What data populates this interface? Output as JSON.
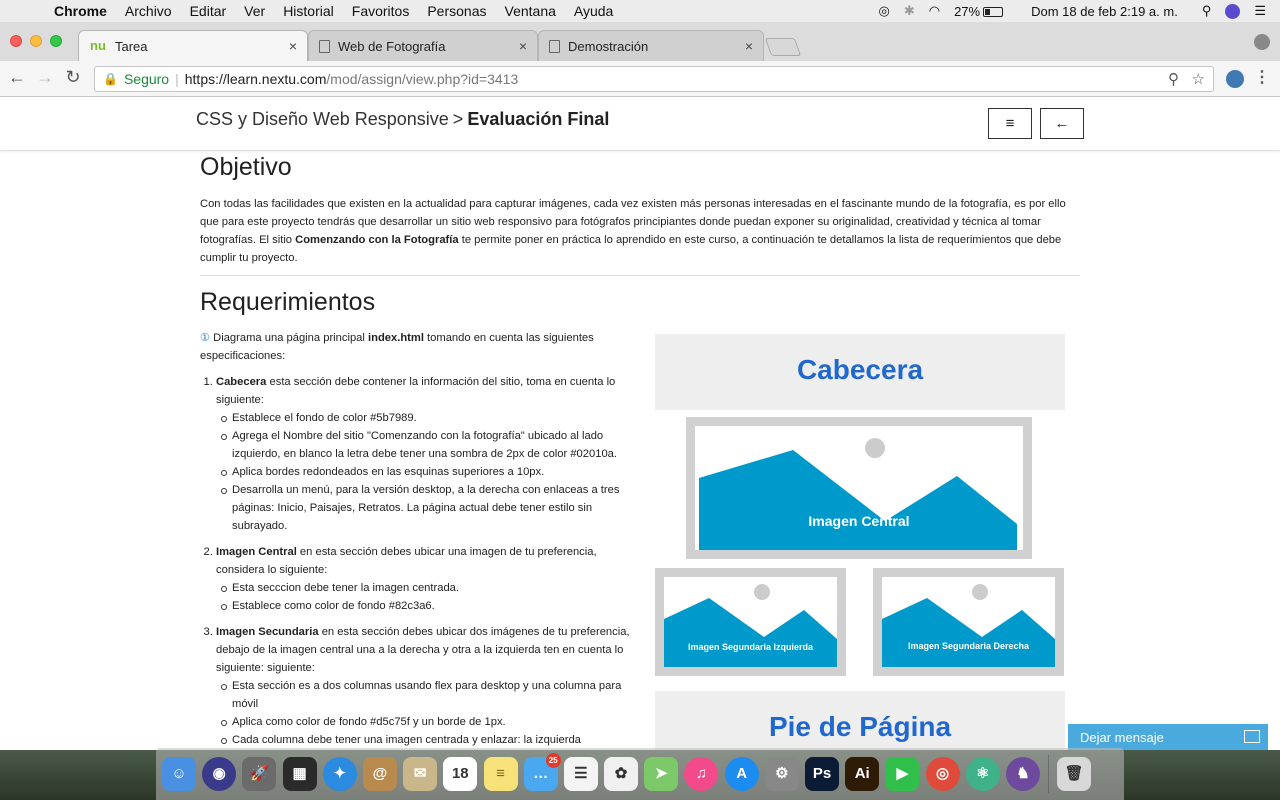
{
  "menubar": {
    "apple": "",
    "app_name": "Chrome",
    "items": [
      "Archivo",
      "Editar",
      "Ver",
      "Historial",
      "Favoritos",
      "Personas",
      "Ventana",
      "Ayuda"
    ],
    "battery": "27%",
    "datetime": "Dom 18 de feb  2:19 a. m."
  },
  "browser": {
    "tabs": [
      {
        "label": "Tarea",
        "favicon": "nextu-logo",
        "favicon_text": "nu",
        "close": "×"
      },
      {
        "label": "Web de Fotografía",
        "favicon": "document-icon",
        "close": "×"
      },
      {
        "label": "Demostración",
        "favicon": "document-icon",
        "close": "×"
      }
    ],
    "secure_label": "Seguro",
    "url_host": "https://learn.nextu.com",
    "url_path": "/mod/assign/view.php?id=3413",
    "back": "←",
    "forward": "→",
    "reload": "↻",
    "zoom": "⚲",
    "star": "☆",
    "menu": "⋮"
  },
  "page": {
    "breadcrumb_course": "CSS y Diseño Web Responsive",
    "breadcrumb_sep": ">",
    "breadcrumb_current": "Evaluación Final",
    "menu_button": "≡",
    "back_button": "←",
    "objective_title": "Objetivo",
    "intro_1": "Con todas las facilidades que existen en la actualidad para capturar imágenes, cada vez existen más personas interesadas en el fascinante mundo de la fotografía, es por ello que para este proyecto tendrás que desarrollar un sitio web responsivo para fotógrafos principiantes donde puedan exponer su originalidad, creatividad y técnica al tomar fotografías. El sitio ",
    "intro_bold": "Comenzando con la Fotografía",
    "intro_2": " te permite poner en práctica lo aprendido en este curso, a continuación te detallamos la lista de requerimientos que debe cumplir tu proyecto.",
    "requirements_title": "Requerimientos",
    "req_number": "①",
    "req_intro_1": " Diagrama una página principal ",
    "req_intro_bold": "index.html",
    "req_intro_2": " tomando en cuenta las siguientes especificaciones:",
    "sections": [
      {
        "name": "Cabecera",
        "text": " esta sección debe contener la información del sitio, toma en cuenta lo siguiente:",
        "bullets": [
          "Establece el fondo de color #5b7989.",
          "Agrega el Nombre del sitio \"Comenzando con la fotografía\" ubicado al lado izquierdo, en blanco la letra debe tener una sombra de 2px de color #02010a.",
          "Aplica bordes redondeados en las esquinas superiores a 10px.",
          "Desarrolla un menú, para la versión desktop, a la derecha con enlaceas a tres páginas: Inicio, Paisajes, Retratos. La página actual debe tener estilo sin subrayado."
        ]
      },
      {
        "name": "Imagen Central",
        "text": " en esta sección debes ubicar una imagen de tu preferencia, considera lo siguiente:",
        "bullets": [
          "Esta secccion debe tener la imagen centrada.",
          "Establece como color de fondo #82c3a6."
        ]
      },
      {
        "name": "Imagen Secundaria",
        "text": " en esta sección debes ubicar dos imágenes de tu preferencia, debajo de la imagen central una a la derecha y otra a la izquierda ten en cuenta lo siguiente: siguiente:",
        "bullets": [
          "Esta sección es a dos columnas usando flex para desktop y una columna para móvil",
          "Aplica como color de fondo #d5c75f y un borde de 1px.",
          "Cada columna debe tener una imagen centrada y enlazar: la izquierda"
        ]
      }
    ],
    "diagram": {
      "header_label": "Cabecera",
      "central_label": "Imagen  Central",
      "secondary_left_label": "Imagen  Segundaria Izquierda",
      "secondary_right_label": "Imagen  Segundaria Derecha",
      "footer_label": "Pie de Página",
      "accent": "#0099cc",
      "label_color": "#2068d0"
    },
    "chat_label": "Dejar mensaje"
  },
  "dock": {
    "apps": [
      {
        "name": "finder",
        "color": "#4a90e2",
        "glyph": "☺"
      },
      {
        "name": "siri",
        "color": "#3a3a8a",
        "glyph": "◉"
      },
      {
        "name": "launchpad",
        "color": "#6b6b6b",
        "glyph": "🚀"
      },
      {
        "name": "photo-booth",
        "color": "#2a2a2a",
        "glyph": "▦"
      },
      {
        "name": "safari",
        "color": "#2a8be0",
        "glyph": "✦"
      },
      {
        "name": "contacts",
        "color": "#b98a4e",
        "glyph": "@"
      },
      {
        "name": "mail",
        "color": "#c9b68a",
        "glyph": "✉"
      },
      {
        "name": "calendar",
        "color": "#ffffff",
        "glyph": "18"
      },
      {
        "name": "notes",
        "color": "#f7e27a",
        "glyph": "≡"
      },
      {
        "name": "messages",
        "color": "#4aa8f0",
        "glyph": "…",
        "badge": "25"
      },
      {
        "name": "reminders",
        "color": "#f4f4f4",
        "glyph": "☰"
      },
      {
        "name": "photos",
        "color": "#f0f0f0",
        "glyph": "✿"
      },
      {
        "name": "maps",
        "color": "#7dc96a",
        "glyph": "➤"
      },
      {
        "name": "itunes",
        "color": "#f24a8a",
        "glyph": "♫"
      },
      {
        "name": "app-store",
        "color": "#1c8cf0",
        "glyph": "A"
      },
      {
        "name": "system-preferences",
        "color": "#888888",
        "glyph": "⚙"
      },
      {
        "name": "photoshop",
        "color": "#0c1b35",
        "glyph": "Ps"
      },
      {
        "name": "illustrator",
        "color": "#2e1a05",
        "glyph": "Ai"
      },
      {
        "name": "facetime",
        "color": "#2fbf4a",
        "glyph": "▶"
      },
      {
        "name": "chrome",
        "color": "#e04a3a",
        "glyph": "◎"
      },
      {
        "name": "atom",
        "color": "#3fb28a",
        "glyph": "⚛"
      },
      {
        "name": "github",
        "color": "#6e4a9e",
        "glyph": "♞"
      },
      {
        "name": "trash",
        "color": "#d8d8d8",
        "glyph": "🗑"
      }
    ]
  }
}
